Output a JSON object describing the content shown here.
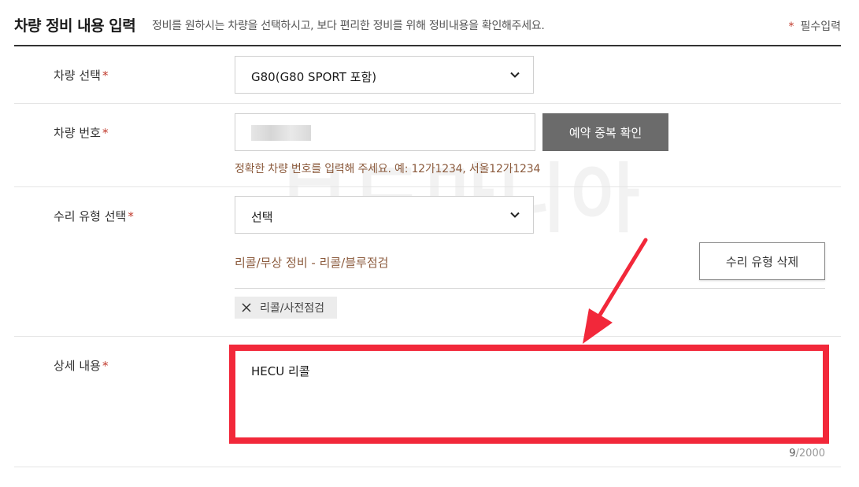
{
  "header": {
    "title": "차량 정비 내용 입력",
    "description": "정비를 원하시는 차량을 선택하시고, 보다 편리한 정비를 위해 정비내용을 확인해주세요.",
    "required_star": "*",
    "required_label": "필수입력"
  },
  "vehicle_select": {
    "label": "차량 선택",
    "value": "G80(G80 SPORT 포함)"
  },
  "vehicle_number": {
    "label": "차량 번호",
    "check_button": "예약 중복 확인",
    "hint": "정확한 차량 번호를 입력해 주세요. 예: 12가1234, 서울12가1234"
  },
  "repair_type": {
    "label": "수리 유형 선택",
    "value": "선택",
    "selected_category": "리콜/무상 정비 - 리콜/블루점검",
    "delete_button": "수리 유형 삭제",
    "tags": [
      "리콜/사전점검"
    ]
  },
  "detail": {
    "label": "상세 내용",
    "text": "HECU 리콜",
    "count_current": "9",
    "count_max": "/2000"
  },
  "star": "*",
  "watermark": "보드마니아",
  "colors": {
    "accent_brown": "#8b5a3c",
    "required_red": "#c0392b",
    "highlight_red": "#f2283a",
    "dark_button": "#6b6b6b"
  }
}
